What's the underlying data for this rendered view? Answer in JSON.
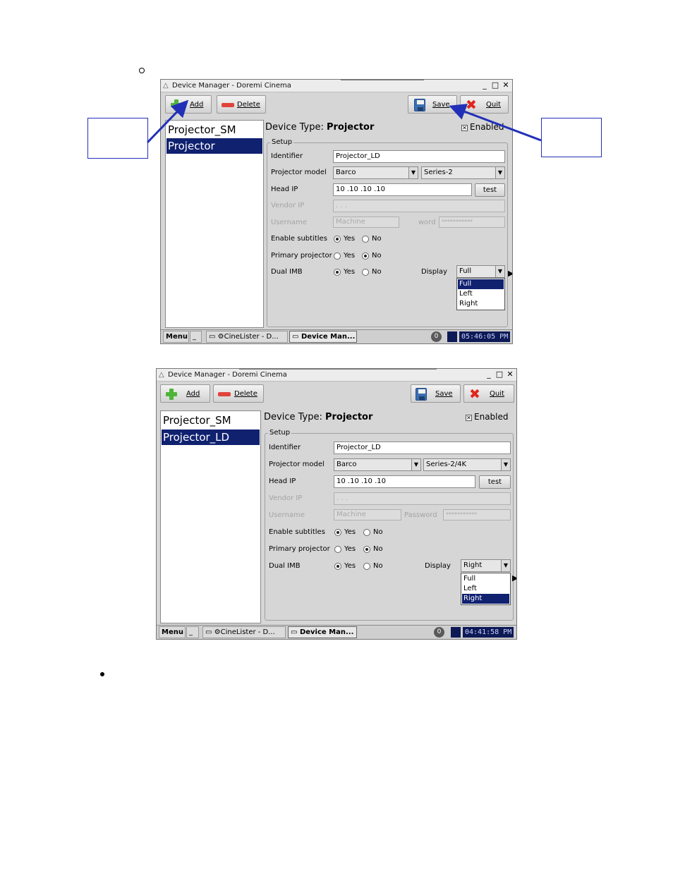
{
  "bullets": {
    "top": "o"
  },
  "colors": {
    "annotation_arrow": "#2230b8",
    "selection": "#102170",
    "window_bg": "#d6d6d6"
  },
  "screens": [
    {
      "title": "Device Manager - Doremi Cinema",
      "toolbar": {
        "add": "Add",
        "delete": "Delete",
        "save": "Save",
        "quit": "Quit"
      },
      "devices": [
        "Projector_SM",
        "Projector"
      ],
      "selected_device": 1,
      "device_type_label": "Device Type:",
      "device_type_value": "Projector",
      "enabled_label": "Enabled",
      "enabled_checked": true,
      "setup_legend": "Setup",
      "identifier_label": "Identifier",
      "identifier_value": "Projector_LD",
      "model_label": "Projector model",
      "model_value": "Barco",
      "series_value": "Series-2",
      "head_ip_label": "Head IP",
      "head_ip_value": "10 .10 .10 .10",
      "test_label": "test",
      "vendor_ip_label": "Vendor IP",
      "vendor_ip_value": ". . .",
      "username_label": "Username",
      "username_value": "Machine",
      "password_label": "word",
      "password_value": "***********",
      "subtitles_label": "Enable subtitles",
      "primary_label": "Primary projector",
      "dualimb_label": "Dual IMB",
      "yes": "Yes",
      "no": "No",
      "display_label": "Display",
      "display_value": "Full",
      "display_options": [
        "Full",
        "Left",
        "Right"
      ],
      "display_selected": 0,
      "taskbar": {
        "menu": "Menu",
        "min": "_",
        "cinelister": "CineLister - D...",
        "devman": "Device Man...",
        "badge": "0",
        "clock": "05:46:05 PM"
      }
    },
    {
      "title": "Device Manager - Doremi Cinema",
      "toolbar": {
        "add": "Add",
        "delete": "Delete",
        "save": "Save",
        "quit": "Quit"
      },
      "devices": [
        "Projector_SM",
        "Projector_LD"
      ],
      "selected_device": 1,
      "device_type_label": "Device Type:",
      "device_type_value": "Projector",
      "enabled_label": "Enabled",
      "enabled_checked": true,
      "setup_legend": "Setup",
      "identifier_label": "Identifier",
      "identifier_value": "Projector_LD",
      "model_label": "Projector model",
      "model_value": "Barco",
      "series_value": "Series-2/4K",
      "head_ip_label": "Head IP",
      "head_ip_value": "10 .10 .10 .10",
      "test_label": "test",
      "vendor_ip_label": "Vendor IP",
      "vendor_ip_value": ". . .",
      "username_label": "Username",
      "username_value": "Machine",
      "password_label": "Password",
      "password_value": "***********",
      "subtitles_label": "Enable subtitles",
      "primary_label": "Primary projector",
      "dualimb_label": "Dual IMB",
      "yes": "Yes",
      "no": "No",
      "display_label": "Display",
      "display_value": "Right",
      "display_options": [
        "Full",
        "Left",
        "Right"
      ],
      "display_selected": 2,
      "taskbar": {
        "menu": "Menu",
        "min": "_",
        "cinelister": "CineLister - D...",
        "devman": "Device Man...",
        "badge": "0",
        "clock": "04:41:58 PM"
      }
    }
  ]
}
